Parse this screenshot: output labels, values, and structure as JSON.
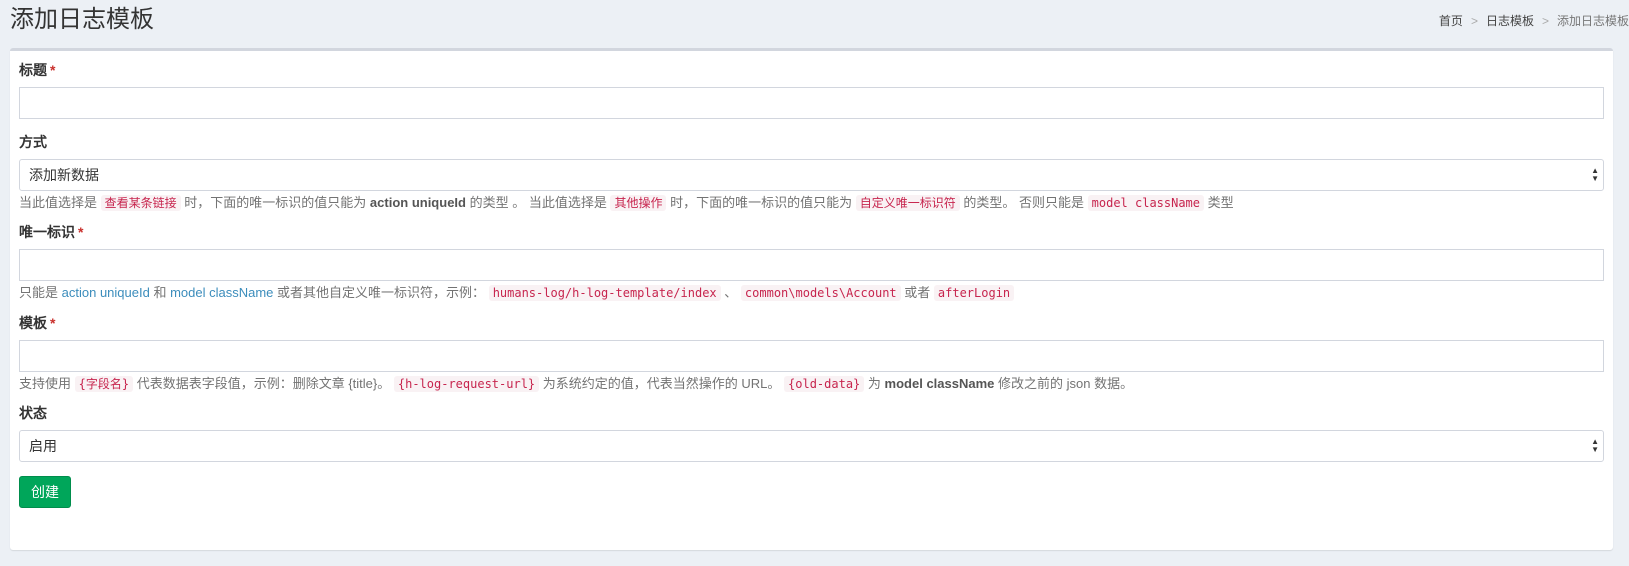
{
  "header": {
    "title": "添加日志模板",
    "breadcrumb": [
      "首页",
      "日志模板",
      "添加日志模板"
    ],
    "separator": ">"
  },
  "form": {
    "title_field": {
      "label": "标题",
      "required_mark": "*",
      "value": ""
    },
    "method_field": {
      "label": "方式",
      "selected": "添加新数据",
      "help": {
        "p1": "当此值选择是",
        "code1": "查看某条链接",
        "p2": "时，下面的唯一标识的值只能为",
        "bold1": "action uniqueId",
        "p3": "的类型 。 当此值选择是",
        "code2": "其他操作",
        "p4": "时，下面的唯一标识的值只能为",
        "code3": "自定义唯一标识符",
        "p5": "的类型。 否则只能是",
        "code4": "model className",
        "p6": "类型"
      }
    },
    "unique_field": {
      "label": "唯一标识",
      "required_mark": "*",
      "value": "",
      "help": {
        "p1": "只能是",
        "link1": "action uniqueId",
        "p2": "和",
        "link2": "model className",
        "p3": "或者其他自定义唯一标识符，示例：",
        "code1": "humans-log/h-log-template/index",
        "p4": "、",
        "code2": "common\\models\\Account",
        "p5": "或者",
        "code3": "afterLogin"
      }
    },
    "template_field": {
      "label": "模板",
      "required_mark": "*",
      "value": "",
      "help": {
        "p1": "支持使用",
        "code1": "{字段名}",
        "p2": "代表数据表字段值，示例：删除文章 {title}。",
        "code2": "{h-log-request-url}",
        "p3": "为系统约定的值，代表当然操作的 URL。",
        "code3": "{old-data}",
        "p4": "为",
        "bold1": "model className",
        "p5": "修改之前的 json 数据。"
      }
    },
    "status_field": {
      "label": "状态",
      "selected": "启用"
    },
    "submit_label": "创建"
  },
  "colors": {
    "primary_button": "#00a65a",
    "code_text": "#c7254e",
    "link": "#3c8dbc",
    "background": "#ecf0f5"
  },
  "icons": {
    "select_arrow": "chevron-up-down-icon"
  }
}
